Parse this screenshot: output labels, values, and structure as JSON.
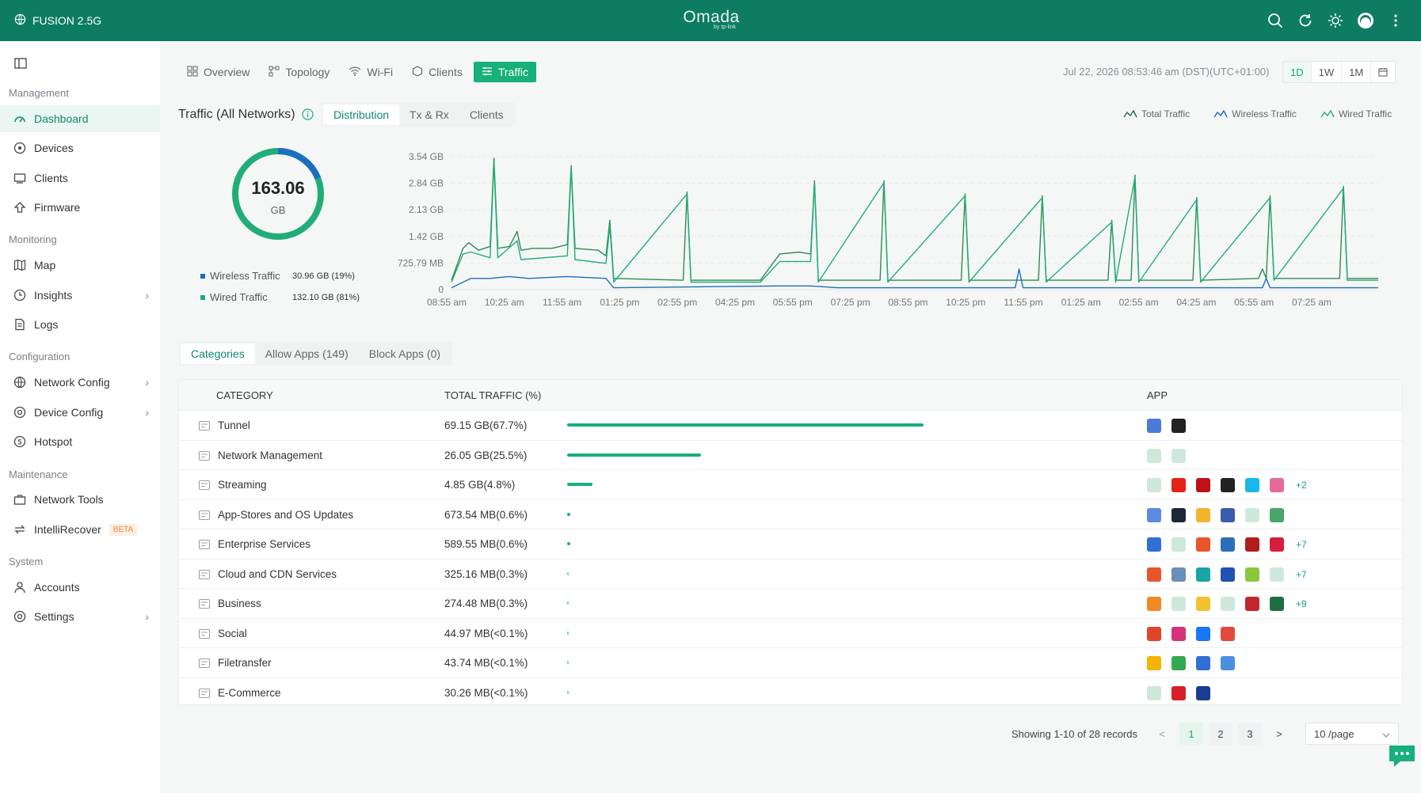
{
  "topbar": {
    "site_name": "FUSION 2.5G",
    "brand": "Omada",
    "brand_sub": "by tp-link"
  },
  "sidebar": {
    "sections": {
      "management": "Management",
      "monitoring": "Monitoring",
      "configuration": "Configuration",
      "maintenance": "Maintenance",
      "system": "System"
    },
    "items": {
      "dashboard": "Dashboard",
      "devices": "Devices",
      "clients": "Clients",
      "firmware": "Firmware",
      "map": "Map",
      "insights": "Insights",
      "logs": "Logs",
      "network_config": "Network Config",
      "device_config": "Device Config",
      "hotspot": "Hotspot",
      "network_tools": "Network Tools",
      "intellirecover": "IntelliRecover",
      "beta": "BETA",
      "accounts": "Accounts",
      "settings": "Settings"
    }
  },
  "tabs": {
    "overview": "Overview",
    "topology": "Topology",
    "wifi": "Wi-Fi",
    "clients": "Clients",
    "traffic": "Traffic"
  },
  "datetime": "Jul 22, 2026 08:53:46 am (DST)(UTC+01:00)",
  "range": {
    "d1": "1D",
    "w1": "1W",
    "m1": "1M"
  },
  "traffic": {
    "title": "Traffic (All Networks)",
    "subtabs": {
      "distribution": "Distribution",
      "txrx": "Tx & Rx",
      "clients": "Clients"
    },
    "legend": {
      "total": "Total Traffic",
      "wireless": "Wireless Traffic",
      "wired": "Wired Traffic"
    },
    "total_value": "163.06",
    "total_unit": "GB",
    "wireless_label": "Wireless Traffic",
    "wireless_value": "30.96 GB (19%)",
    "wired_label": "Wired Traffic",
    "wired_value": "132.10 GB (81%)"
  },
  "colors": {
    "accent": "#17b07a",
    "topbar": "#0e7c63",
    "wireless": "#1a6fc0",
    "wired": "#1fae77"
  },
  "chart_data": {
    "type": "line",
    "y_ticks": [
      "3.54 GB",
      "2.84 GB",
      "2.13 GB",
      "1.42 GB",
      "725.79 MB",
      "0"
    ],
    "x_ticks": [
      "08:55 am",
      "10:25 am",
      "11:55 am",
      "01:25 pm",
      "02:55 pm",
      "04:25 pm",
      "05:55 pm",
      "07:25 pm",
      "08:55 pm",
      "10:25 pm",
      "11:55 pm",
      "01:25 am",
      "02:55 am",
      "04:25 am",
      "05:55 am",
      "07:25 am"
    ],
    "y_unit": "GB",
    "ylim": [
      0,
      3.54
    ],
    "grid": true,
    "legend_position": "top-right",
    "series": [
      {
        "name": "Total Traffic",
        "color": "#2e8b57",
        "points": [
          [
            0,
            0.25
          ],
          [
            0.3,
            1.1
          ],
          [
            0.45,
            1.25
          ],
          [
            0.7,
            1.05
          ],
          [
            1.0,
            1.15
          ],
          [
            1.1,
            3.5
          ],
          [
            1.2,
            1.1
          ],
          [
            1.5,
            1.15
          ],
          [
            1.7,
            1.55
          ],
          [
            1.8,
            1.05
          ],
          [
            2.1,
            1.1
          ],
          [
            2.6,
            1.1
          ],
          [
            3.0,
            1.2
          ],
          [
            3.1,
            3.3
          ],
          [
            3.2,
            1.1
          ],
          [
            3.8,
            1.05
          ],
          [
            4.0,
            0.9
          ],
          [
            4.1,
            1.85
          ],
          [
            4.2,
            0.3
          ],
          [
            6.0,
            0.25
          ],
          [
            6.1,
            2.6
          ],
          [
            6.2,
            0.25
          ],
          [
            8.0,
            0.25
          ],
          [
            8.5,
            0.95
          ],
          [
            9.0,
            1.0
          ],
          [
            9.3,
            0.95
          ],
          [
            9.4,
            2.9
          ],
          [
            9.5,
            0.25
          ],
          [
            11.1,
            0.25
          ],
          [
            11.2,
            2.9
          ],
          [
            11.3,
            0.25
          ],
          [
            13.2,
            0.25
          ],
          [
            13.3,
            2.55
          ],
          [
            13.4,
            0.25
          ],
          [
            15.2,
            0.25
          ],
          [
            15.3,
            2.5
          ],
          [
            15.4,
            0.25
          ],
          [
            17.0,
            0.25
          ],
          [
            17.1,
            1.85
          ],
          [
            17.2,
            0.25
          ],
          [
            17.6,
            0.25
          ],
          [
            17.7,
            3.05
          ],
          [
            17.8,
            0.25
          ],
          [
            19.2,
            0.25
          ],
          [
            19.3,
            2.45
          ],
          [
            19.4,
            0.25
          ],
          [
            20.9,
            0.3
          ],
          [
            21.0,
            0.55
          ],
          [
            21.1,
            0.3
          ],
          [
            21.2,
            2.5
          ],
          [
            21.3,
            0.3
          ],
          [
            23.0,
            0.3
          ],
          [
            23.1,
            2.75
          ],
          [
            23.2,
            0.3
          ],
          [
            24.0,
            0.3
          ]
        ]
      },
      {
        "name": "Wireless Traffic",
        "color": "#1a6fc0",
        "points": [
          [
            0,
            0.05
          ],
          [
            0.5,
            0.3
          ],
          [
            1.0,
            0.3
          ],
          [
            1.5,
            0.35
          ],
          [
            2.0,
            0.3
          ],
          [
            3.0,
            0.35
          ],
          [
            4.0,
            0.3
          ],
          [
            4.2,
            0.05
          ],
          [
            8.5,
            0.1
          ],
          [
            9.3,
            0.1
          ],
          [
            10.0,
            0.05
          ],
          [
            14.6,
            0.05
          ],
          [
            14.7,
            0.55
          ],
          [
            14.8,
            0.05
          ],
          [
            21.0,
            0.05
          ],
          [
            21.1,
            0.3
          ],
          [
            21.2,
            0.05
          ],
          [
            24.0,
            0.05
          ]
        ]
      },
      {
        "name": "Wired Traffic",
        "color": "#1fae77",
        "points": [
          [
            0,
            0.2
          ],
          [
            0.3,
            0.95
          ],
          [
            0.5,
            1.0
          ],
          [
            1.0,
            0.85
          ],
          [
            1.1,
            3.4
          ],
          [
            1.2,
            0.85
          ],
          [
            1.7,
            1.3
          ],
          [
            1.8,
            0.8
          ],
          [
            3.0,
            0.9
          ],
          [
            3.1,
            3.25
          ],
          [
            3.2,
            0.8
          ],
          [
            4.0,
            0.7
          ],
          [
            4.1,
            1.7
          ],
          [
            4.2,
            0.2
          ],
          [
            6.1,
            2.55
          ],
          [
            6.2,
            0.2
          ],
          [
            8.0,
            0.2
          ],
          [
            8.5,
            0.75
          ],
          [
            9.3,
            0.75
          ],
          [
            9.4,
            2.85
          ],
          [
            9.5,
            0.2
          ],
          [
            11.2,
            2.85
          ],
          [
            11.3,
            0.2
          ],
          [
            13.3,
            2.5
          ],
          [
            13.4,
            0.2
          ],
          [
            15.3,
            2.45
          ],
          [
            15.4,
            0.2
          ],
          [
            17.1,
            1.8
          ],
          [
            17.2,
            0.2
          ],
          [
            17.7,
            3.0
          ],
          [
            17.8,
            0.2
          ],
          [
            19.3,
            2.4
          ],
          [
            19.4,
            0.2
          ],
          [
            21.2,
            2.45
          ],
          [
            21.3,
            0.25
          ],
          [
            23.1,
            2.7
          ],
          [
            23.2,
            0.25
          ],
          [
            24.0,
            0.25
          ]
        ]
      }
    ]
  },
  "categories_tabs": {
    "categories": "Categories",
    "allow": "Allow Apps (149)",
    "block": "Block Apps (0)"
  },
  "table": {
    "headers": {
      "category": "CATEGORY",
      "total": "TOTAL TRAFFIC (%)",
      "app": "APP"
    },
    "rows": [
      {
        "name": "Tunnel",
        "total": "69.15 GB(67.7%)",
        "pct": 67.7,
        "apps": [
          "#4a7bd8",
          "#222"
        ],
        "more": ""
      },
      {
        "name": "Network Management",
        "total": "26.05 GB(25.5%)",
        "pct": 25.5,
        "apps": [
          "#cfe8dc",
          "#cfe8dc"
        ],
        "more": ""
      },
      {
        "name": "Streaming",
        "total": "4.85 GB(4.8%)",
        "pct": 4.8,
        "apps": [
          "#cfe8dc",
          "#e62117",
          "#c0101a",
          "#222",
          "#1ab7ea",
          "#e56a9a"
        ],
        "more": "+2"
      },
      {
        "name": "App-Stores and OS Updates",
        "total": "673.54 MB(0.6%)",
        "pct": 0.6,
        "apps": [
          "#5b8be0",
          "#1b2838",
          "#f2b52e",
          "#3b5bad",
          "#cfe8dc",
          "#4aa66a"
        ],
        "more": ""
      },
      {
        "name": "Enterprise Services",
        "total": "589.55 MB(0.6%)",
        "pct": 0.6,
        "apps": [
          "#2f6fd6",
          "#cfe8dc",
          "#e8552b",
          "#2c6fb8",
          "#b11d1d",
          "#d61f3c"
        ],
        "more": "+7"
      },
      {
        "name": "Cloud and CDN Services",
        "total": "325.16 MB(0.3%)",
        "pct": 0.3,
        "apps": [
          "#e8552b",
          "#6a8fb8",
          "#17a6a1",
          "#2152b3",
          "#8cc63f",
          "#cfe8dc"
        ],
        "more": "+7"
      },
      {
        "name": "Business",
        "total": "274.48 MB(0.3%)",
        "pct": 0.3,
        "apps": [
          "#f08a24",
          "#cfe8dc",
          "#f2c230",
          "#cfe8dc",
          "#c4262e",
          "#1f6e43"
        ],
        "more": "+9"
      },
      {
        "name": "Social",
        "total": "44.97 MB(<0.1%)",
        "pct": 0.05,
        "apps": [
          "#e0452b",
          "#d6327a",
          "#1877f2",
          "#e34a3d"
        ],
        "more": ""
      },
      {
        "name": "Filetransfer",
        "total": "43.74 MB(<0.1%)",
        "pct": 0.05,
        "apps": [
          "#f4b400",
          "#34a853",
          "#2f6fd6",
          "#4b8fe0"
        ],
        "more": ""
      },
      {
        "name": "E-Commerce",
        "total": "30.26 MB(<0.1%)",
        "pct": 0.05,
        "apps": [
          "#cfe8dc",
          "#d6202a",
          "#1b3d8f"
        ],
        "more": ""
      }
    ]
  },
  "pager": {
    "summary": "Showing 1-10 of 28 records",
    "prev": "<",
    "next": ">",
    "p1": "1",
    "p2": "2",
    "p3": "3",
    "per_page": "10 /page"
  }
}
